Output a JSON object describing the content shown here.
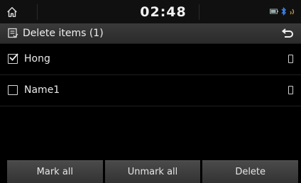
{
  "status": {
    "time": "02:48",
    "home_icon": "home-icon",
    "icons": [
      "battery-icon",
      "bluetooth-icon",
      "signal-icon"
    ]
  },
  "header": {
    "title": "Delete items (1)",
    "title_icon": "delete-list-icon",
    "back_icon": "back-arrow-icon"
  },
  "list": {
    "items": [
      {
        "label": "Hong",
        "checked": true
      },
      {
        "label": "Name1",
        "checked": false
      }
    ]
  },
  "footer": {
    "mark_all": "Mark all",
    "unmark_all": "Unmark all",
    "delete": "Delete"
  },
  "colors": {
    "background": "#000000",
    "titlebar": "#333333",
    "button": "#3d3d3d",
    "text": "#e8e8e8"
  }
}
